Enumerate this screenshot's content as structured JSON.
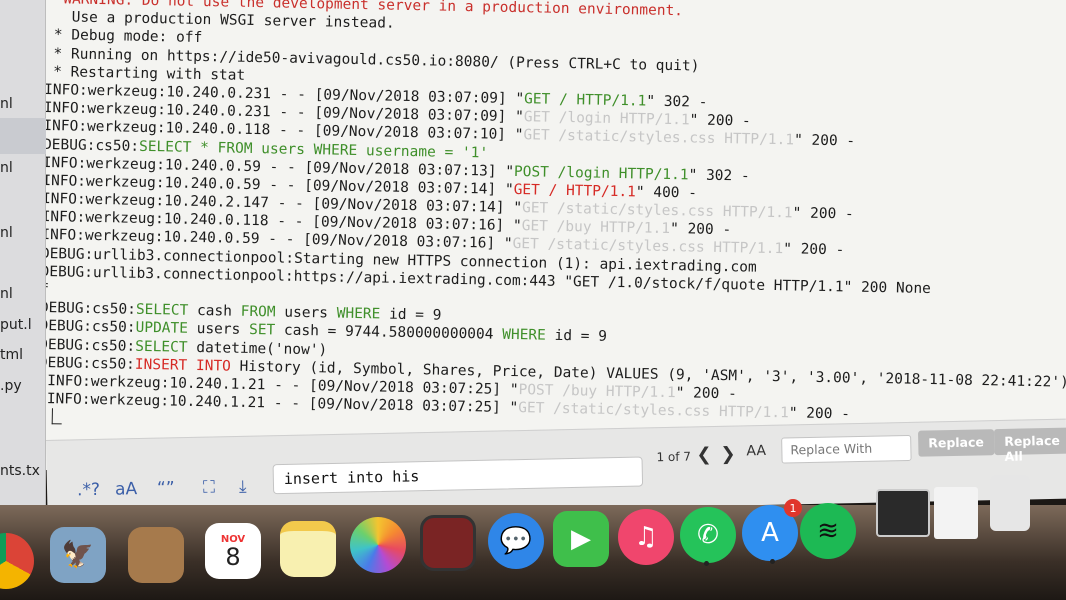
{
  "sidebar": {
    "files": [
      {
        "label": "nl"
      },
      {
        "label": "nl"
      },
      {
        "label": "nl"
      },
      {
        "label": "nl"
      },
      {
        "label": "put.l"
      },
      {
        "label": "tml"
      },
      {
        "label": ".py"
      },
      {
        "label": "nts.tx"
      }
    ]
  },
  "terminal": {
    "lines": [
      {
        "indent": "  ",
        "parts": [
          {
            "t": "WARNING: Do not use the development server in a production environment.",
            "c": "warn"
          }
        ]
      },
      {
        "indent": "   ",
        "parts": [
          {
            "t": "Use a production WSGI server instead.",
            "c": ""
          }
        ]
      },
      {
        "indent": " ",
        "parts": [
          {
            "t": "* Debug mode: off",
            "c": ""
          }
        ]
      },
      {
        "indent": " ",
        "parts": [
          {
            "t": "* Running on https://ide50-avivagould.cs50.io:8080/ (Press CTRL+C to quit)",
            "c": ""
          }
        ]
      },
      {
        "indent": " ",
        "parts": [
          {
            "t": "* Restarting with stat",
            "c": ""
          }
        ]
      },
      {
        "indent": "",
        "parts": [
          {
            "t": "INFO:werkzeug:10.240.0.231 - - [09/Nov/2018 03:07:09] \"",
            "c": ""
          },
          {
            "t": "GET / HTTP/1.1",
            "c": "req-ok"
          },
          {
            "t": "\" 302 -",
            "c": ""
          }
        ]
      },
      {
        "indent": "",
        "parts": [
          {
            "t": "INFO:werkzeug:10.240.0.231 - - [09/Nov/2018 03:07:09] \"",
            "c": ""
          },
          {
            "t": "GET /login HTTP/1.1",
            "c": "req-dim"
          },
          {
            "t": "\" 200 -",
            "c": ""
          }
        ]
      },
      {
        "indent": "",
        "parts": [
          {
            "t": "INFO:werkzeug:10.240.0.118 - - [09/Nov/2018 03:07:10] \"",
            "c": ""
          },
          {
            "t": "GET /static/styles.css HTTP/1.1",
            "c": "req-dim"
          },
          {
            "t": "\" 200 -",
            "c": ""
          }
        ]
      },
      {
        "indent": "",
        "parts": [
          {
            "t": "DEBUG:cs50:",
            "c": ""
          },
          {
            "t": "SELECT * FROM users WHERE username = '1'",
            "c": "sqlkw"
          }
        ]
      },
      {
        "indent": "",
        "parts": [
          {
            "t": "INFO:werkzeug:10.240.0.59 - - [09/Nov/2018 03:07:13] \"",
            "c": ""
          },
          {
            "t": "POST /login HTTP/1.1",
            "c": "req-ok"
          },
          {
            "t": "\" 302 -",
            "c": ""
          }
        ]
      },
      {
        "indent": "",
        "parts": [
          {
            "t": "INFO:werkzeug:10.240.0.59 - - [09/Nov/2018 03:07:14] \"",
            "c": ""
          },
          {
            "t": "GET / HTTP/1.1",
            "c": "req-bad"
          },
          {
            "t": "\" 400 -",
            "c": ""
          }
        ]
      },
      {
        "indent": "",
        "parts": [
          {
            "t": "INFO:werkzeug:10.240.2.147 - - [09/Nov/2018 03:07:14] \"",
            "c": ""
          },
          {
            "t": "GET /static/styles.css HTTP/1.1",
            "c": "req-dim"
          },
          {
            "t": "\" 200 -",
            "c": ""
          }
        ]
      },
      {
        "indent": "",
        "parts": [
          {
            "t": "INFO:werkzeug:10.240.0.118 - - [09/Nov/2018 03:07:16] \"",
            "c": ""
          },
          {
            "t": "GET /buy HTTP/1.1",
            "c": "req-dim"
          },
          {
            "t": "\" 200 -",
            "c": ""
          }
        ]
      },
      {
        "indent": "",
        "parts": [
          {
            "t": "INFO:werkzeug:10.240.0.59 - - [09/Nov/2018 03:07:16] \"",
            "c": ""
          },
          {
            "t": "GET /static/styles.css HTTP/1.1",
            "c": "req-dim"
          },
          {
            "t": "\" 200 -",
            "c": ""
          }
        ]
      },
      {
        "indent": "",
        "parts": [
          {
            "t": "DEBUG:urllib3.connectionpool:Starting new HTTPS connection (1): api.iextrading.com",
            "c": ""
          }
        ]
      },
      {
        "indent": "",
        "parts": [
          {
            "t": "DEBUG:urllib3.connectionpool:https://api.iextrading.com:443 \"GET /1.0/stock/f/quote HTTP/1.1\" 200 None",
            "c": ""
          }
        ]
      },
      {
        "indent": "",
        "parts": [
          {
            "t": "f",
            "c": ""
          }
        ]
      },
      {
        "indent": "",
        "parts": [
          {
            "t": "DEBUG:cs50:",
            "c": ""
          },
          {
            "t": "SELECT",
            "c": "sqlkw"
          },
          {
            "t": " cash ",
            "c": ""
          },
          {
            "t": "FROM",
            "c": "sqlkw"
          },
          {
            "t": " users ",
            "c": ""
          },
          {
            "t": "WHERE",
            "c": "sqlkw"
          },
          {
            "t": " id = 9",
            "c": ""
          }
        ]
      },
      {
        "indent": "",
        "parts": [
          {
            "t": "DEBUG:cs50:",
            "c": ""
          },
          {
            "t": "UPDATE",
            "c": "sqlkw"
          },
          {
            "t": " users ",
            "c": ""
          },
          {
            "t": "SET",
            "c": "sqlkw"
          },
          {
            "t": " cash = 9744.580000000004 ",
            "c": ""
          },
          {
            "t": "WHERE",
            "c": "sqlkw"
          },
          {
            "t": " id = 9",
            "c": ""
          }
        ]
      },
      {
        "indent": "",
        "parts": [
          {
            "t": "DEBUG:cs50:",
            "c": ""
          },
          {
            "t": "SELECT",
            "c": "sqlkw"
          },
          {
            "t": " datetime('now')",
            "c": ""
          }
        ]
      },
      {
        "indent": "",
        "parts": [
          {
            "t": "DEBUG:cs50:",
            "c": ""
          },
          {
            "t": "INSERT INTO",
            "c": "req-bad"
          },
          {
            "t": " History (id, Symbol, Shares, Price, Date) VALUES (9, 'ASM', '3', '3.00', '2018-11-08 22:41:22')",
            "c": ""
          }
        ]
      },
      {
        "indent": " ",
        "parts": [
          {
            "t": "INFO:werkzeug:10.240.1.21 - - [09/Nov/2018 03:07:25] \"",
            "c": ""
          },
          {
            "t": "POST /buy HTTP/1.1",
            "c": "req-dim"
          },
          {
            "t": "\" 200 -",
            "c": ""
          }
        ]
      },
      {
        "indent": " ",
        "parts": [
          {
            "t": "INFO:werkzeug:10.240.1.21 - - [09/Nov/2018 03:07:25] \"",
            "c": ""
          },
          {
            "t": "GET /static/styles.css HTTP/1.1",
            "c": "req-dim"
          },
          {
            "t": "\" 200 -",
            "c": ""
          }
        ]
      }
    ]
  },
  "findbar": {
    "regex_label": ".*?",
    "case_label": "aA",
    "word_label": "“”",
    "selection_icon": "selection-icon",
    "wrap_icon": "wrap-icon",
    "search_value": "insert into his",
    "match_count": "1 of 7",
    "prev_glyph": "❮",
    "next_glyph": "❯",
    "preserve_case_label": "AA",
    "replace_placeholder": "Replace With",
    "replace_label": "Replace",
    "replace_all_label": "Replace All"
  },
  "dock": {
    "calendar_month": "NOV",
    "calendar_day": "8",
    "appstore_badge": "1",
    "icons": [
      "chrome-icon",
      "preview-icon",
      "contacts-icon",
      "calendar-icon",
      "notes-icon",
      "photos-icon",
      "photo-booth-icon",
      "messages-icon",
      "facetime-icon",
      "music-icon",
      "whatsapp-icon",
      "app-store-icon",
      "spotify-icon",
      "screenshot-icon",
      "document-icon",
      "trash-icon"
    ]
  }
}
